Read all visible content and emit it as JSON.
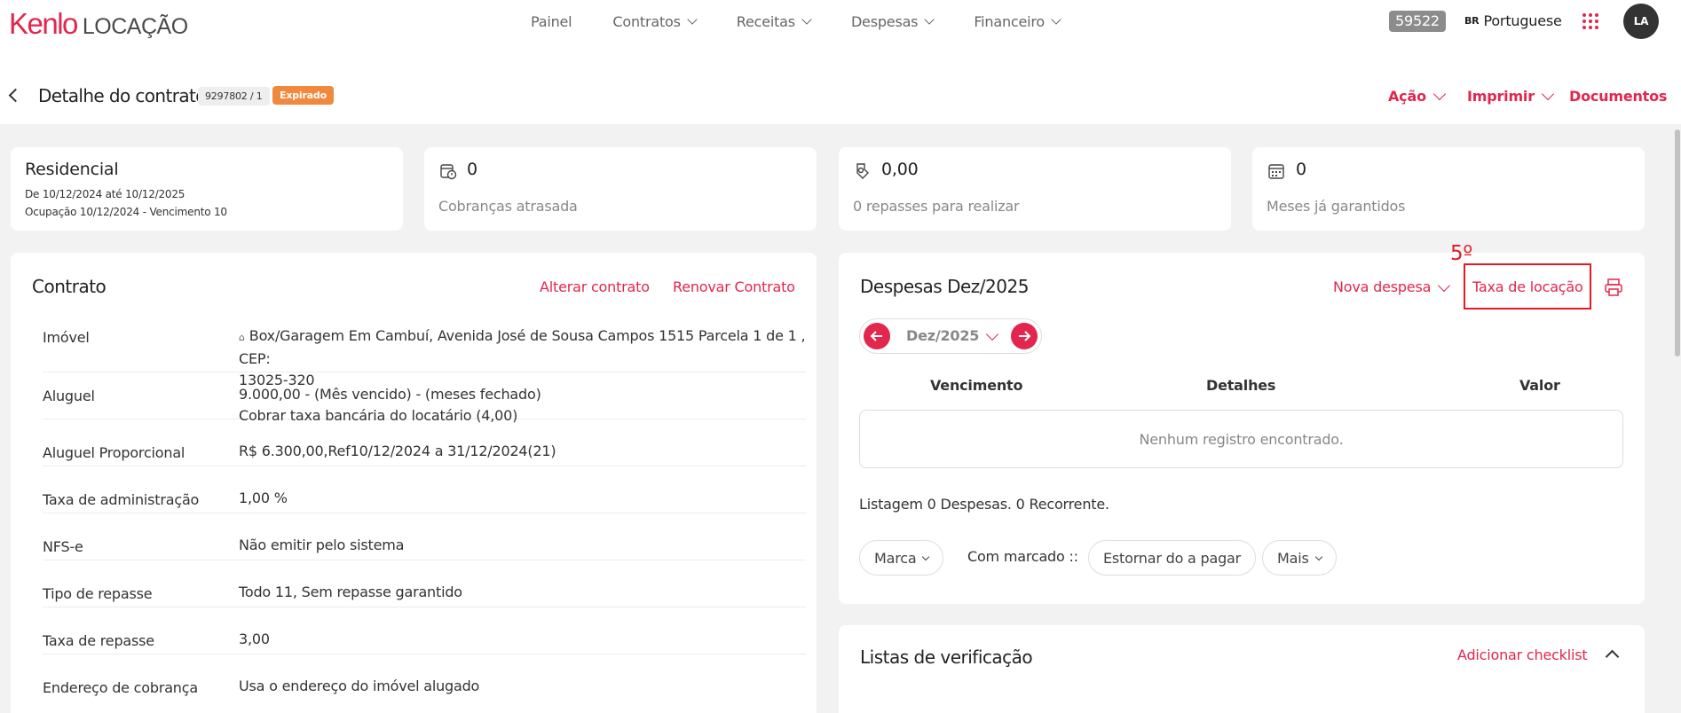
{
  "header": {
    "brand": "Kenlo",
    "brand_sub": "LOCAÇÃO",
    "nav": [
      "Painel",
      "Contratos",
      "Receitas",
      "Despesas",
      "Financeiro"
    ],
    "code": "59522",
    "lang_flag": "BR",
    "language": "Portuguese",
    "avatar": "LA"
  },
  "page": {
    "title": "Detalhe do contrato",
    "contract_number": "9297802 / 1",
    "status": "Expirado",
    "actions": [
      "Ação",
      "Imprimir",
      "Documentos"
    ]
  },
  "summary": {
    "type": "Residencial",
    "period": "De 10/12/2024 até 10/12/2025",
    "occupancy": "Ocupação 10/12/2024 - Vencimento 10",
    "stats": [
      {
        "value": "0",
        "label": "Cobranças atrasada",
        "icon": "overdue-billing-icon"
      },
      {
        "value": "0,00",
        "label": "0 repasses para realizar",
        "icon": "transfer-icon"
      },
      {
        "value": "0",
        "label": "Meses já garantidos",
        "icon": "calendar-icon"
      }
    ]
  },
  "contract": {
    "title": "Contrato",
    "alter": "Alterar contrato",
    "renew": "Renovar Contrato",
    "rows": [
      {
        "label": "Imóvel",
        "value": "Box/Garagem Em Cambuí, Avenida José de Sousa Campos 1515 Parcela 1 de 1 , CEP:",
        "value2": "13025-320"
      },
      {
        "label": "Aluguel",
        "value": "9.000,00 - (Mês vencido) - (meses fechado)",
        "value2": "Cobrar taxa bancária do locatário (4,00)"
      },
      {
        "label": "Aluguel Proporcional",
        "value": "R$ 6.300,00,Ref10/12/2024 a 31/12/2024(21)"
      },
      {
        "label": "Taxa de administração",
        "value": "1,00 %"
      },
      {
        "label": "NFS-e",
        "value": "Não emitir pelo sistema"
      },
      {
        "label": "Tipo de repasse",
        "value": "Todo 11, Sem repasse garantido"
      },
      {
        "label": "Taxa de repasse",
        "value": "3,00"
      },
      {
        "label": "Endereço de cobrança",
        "value": "Usa o endereço do imóvel alugado"
      }
    ]
  },
  "expenses": {
    "title": "Despesas Dez/2025",
    "new_expense": "Nova despesa",
    "rental_fee": "Taxa de locação",
    "annotation": "5º",
    "month": "Dez/2025",
    "columns": [
      "Vencimento",
      "Detalhes",
      "Valor"
    ],
    "empty": "Nenhum registro encontrado.",
    "summary": "Listagem 0 Despesas. 0 Recorrente.",
    "mark": "Marca",
    "with_marked": "Com marcado ::",
    "reverse": "Estornar do a pagar",
    "more": "Mais"
  },
  "checklists": {
    "title": "Listas de verificação",
    "add": "Adicionar checklist"
  },
  "colors": {
    "accent": "#e2264d",
    "badge_orange": "#f0883e",
    "annotation": "#e31b23"
  }
}
